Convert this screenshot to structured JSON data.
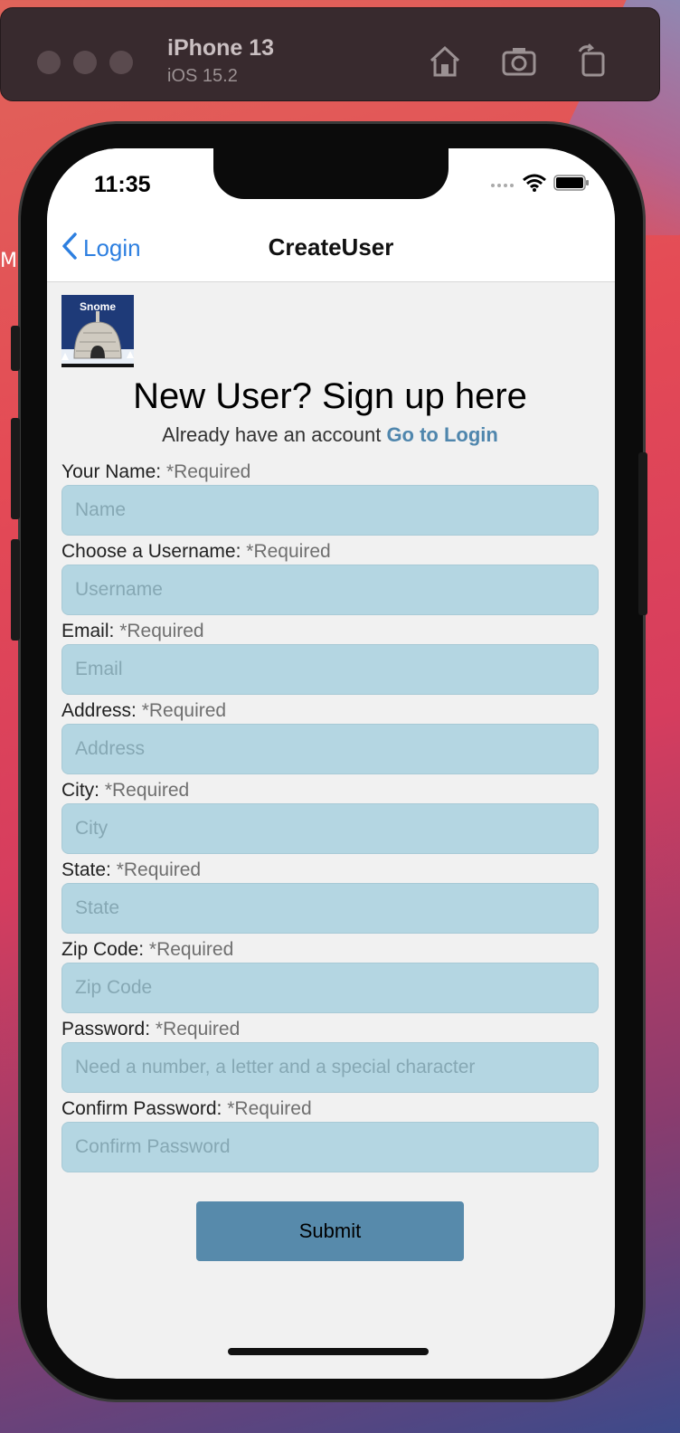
{
  "simulator": {
    "device_name": "iPhone 13",
    "os_version": "iOS 15.2",
    "icons": [
      "home-icon",
      "screenshot-icon",
      "rotate-icon"
    ]
  },
  "status_bar": {
    "time": "11:35",
    "icons": [
      "signal-icon",
      "wifi-icon",
      "battery-icon"
    ]
  },
  "nav": {
    "back_label": "Login",
    "title": "CreateUser"
  },
  "logo": {
    "text": "Snome"
  },
  "header": {
    "headline": "New User? Sign up here",
    "prompt": "Already have an account",
    "login_link": "Go to Login"
  },
  "form": {
    "fields": [
      {
        "label": "Your Name:",
        "required": "*Required",
        "placeholder": "Name",
        "value": ""
      },
      {
        "label": "Choose a Username:",
        "required": "*Required",
        "placeholder": "Username",
        "value": ""
      },
      {
        "label": "Email:",
        "required": "*Required",
        "placeholder": "Email",
        "value": ""
      },
      {
        "label": "Address:",
        "required": "*Required",
        "placeholder": "Address",
        "value": ""
      },
      {
        "label": "City:",
        "required": "*Required",
        "placeholder": "City",
        "value": ""
      },
      {
        "label": "State:",
        "required": "*Required",
        "placeholder": "State",
        "value": ""
      },
      {
        "label": "Zip Code:",
        "required": "*Required",
        "placeholder": "Zip Code",
        "value": ""
      },
      {
        "label": "Password:",
        "required": "*Required",
        "placeholder": "Need a number, a letter and a special character",
        "value": ""
      },
      {
        "label": "Confirm Password:",
        "required": "*Required",
        "placeholder": "Confirm Password",
        "value": ""
      }
    ],
    "submit_label": "Submit"
  },
  "colors": {
    "accent": "#2d7fe0",
    "link": "#4f86ad",
    "input_bg": "#b4d6e2",
    "button_bg": "#578aab"
  }
}
